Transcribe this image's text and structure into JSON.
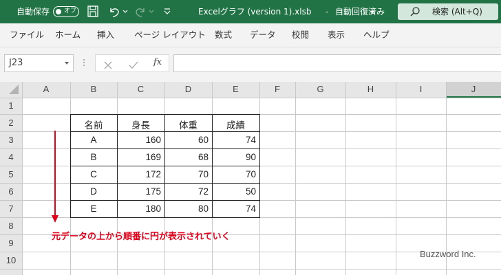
{
  "titlebar": {
    "autosave_label": "自動保存",
    "autosave_state": "オフ",
    "filename": "Excelグラフ (version 1).xlsb",
    "separator": "-",
    "status": "自動回復済み",
    "search_placeholder": "検索 (Alt+Q)"
  },
  "menu": [
    "ファイル",
    "ホーム",
    "挿入",
    "ページ レイアウト",
    "数式",
    "データ",
    "校閲",
    "表示",
    "ヘルプ"
  ],
  "formula_bar": {
    "name_box": "J23",
    "fx": "fx",
    "formula": ""
  },
  "sheet": {
    "columns": [
      "A",
      "B",
      "C",
      "D",
      "E",
      "F",
      "G",
      "H",
      "I",
      "J"
    ],
    "rows": [
      "1",
      "2",
      "3",
      "4",
      "5",
      "6",
      "7",
      "8",
      "9",
      "10"
    ],
    "table_header": [
      "名前",
      "身長",
      "体重",
      "成績"
    ],
    "table_rows": [
      [
        "A",
        "160",
        "60",
        "74"
      ],
      [
        "B",
        "169",
        "68",
        "90"
      ],
      [
        "C",
        "172",
        "70",
        "70"
      ],
      [
        "D",
        "175",
        "72",
        "50"
      ],
      [
        "E",
        "180",
        "80",
        "74"
      ]
    ]
  },
  "annotation": "元データの上から順番に円が表示されていく",
  "watermark": "Buzzword Inc.",
  "colors": {
    "accent": "#217346",
    "annotation_red": "#e0001a",
    "selected_col_header": "#d2d2d2"
  }
}
